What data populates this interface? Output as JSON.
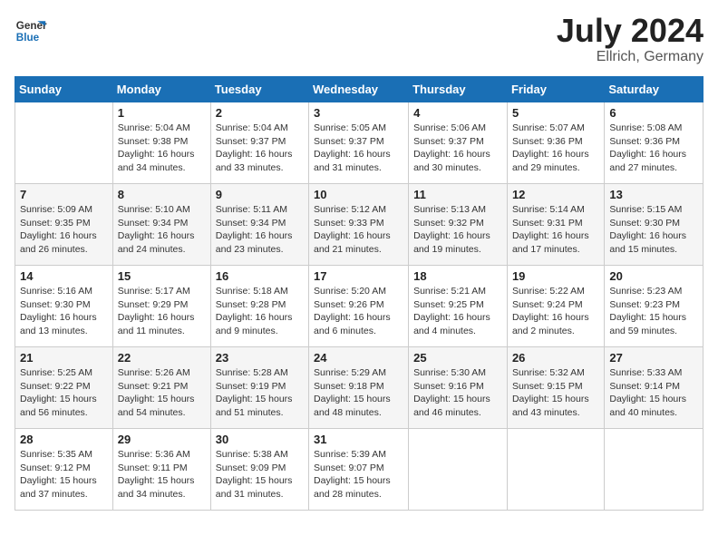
{
  "header": {
    "logo_line1": "General",
    "logo_line2": "Blue",
    "month": "July 2024",
    "location": "Ellrich, Germany"
  },
  "weekdays": [
    "Sunday",
    "Monday",
    "Tuesday",
    "Wednesday",
    "Thursday",
    "Friday",
    "Saturday"
  ],
  "weeks": [
    [
      {
        "day": "",
        "sunrise": "",
        "sunset": "",
        "daylight": ""
      },
      {
        "day": "1",
        "sunrise": "Sunrise: 5:04 AM",
        "sunset": "Sunset: 9:38 PM",
        "daylight": "Daylight: 16 hours and 34 minutes."
      },
      {
        "day": "2",
        "sunrise": "Sunrise: 5:04 AM",
        "sunset": "Sunset: 9:37 PM",
        "daylight": "Daylight: 16 hours and 33 minutes."
      },
      {
        "day": "3",
        "sunrise": "Sunrise: 5:05 AM",
        "sunset": "Sunset: 9:37 PM",
        "daylight": "Daylight: 16 hours and 31 minutes."
      },
      {
        "day": "4",
        "sunrise": "Sunrise: 5:06 AM",
        "sunset": "Sunset: 9:37 PM",
        "daylight": "Daylight: 16 hours and 30 minutes."
      },
      {
        "day": "5",
        "sunrise": "Sunrise: 5:07 AM",
        "sunset": "Sunset: 9:36 PM",
        "daylight": "Daylight: 16 hours and 29 minutes."
      },
      {
        "day": "6",
        "sunrise": "Sunrise: 5:08 AM",
        "sunset": "Sunset: 9:36 PM",
        "daylight": "Daylight: 16 hours and 27 minutes."
      }
    ],
    [
      {
        "day": "7",
        "sunrise": "Sunrise: 5:09 AM",
        "sunset": "Sunset: 9:35 PM",
        "daylight": "Daylight: 16 hours and 26 minutes."
      },
      {
        "day": "8",
        "sunrise": "Sunrise: 5:10 AM",
        "sunset": "Sunset: 9:34 PM",
        "daylight": "Daylight: 16 hours and 24 minutes."
      },
      {
        "day": "9",
        "sunrise": "Sunrise: 5:11 AM",
        "sunset": "Sunset: 9:34 PM",
        "daylight": "Daylight: 16 hours and 23 minutes."
      },
      {
        "day": "10",
        "sunrise": "Sunrise: 5:12 AM",
        "sunset": "Sunset: 9:33 PM",
        "daylight": "Daylight: 16 hours and 21 minutes."
      },
      {
        "day": "11",
        "sunrise": "Sunrise: 5:13 AM",
        "sunset": "Sunset: 9:32 PM",
        "daylight": "Daylight: 16 hours and 19 minutes."
      },
      {
        "day": "12",
        "sunrise": "Sunrise: 5:14 AM",
        "sunset": "Sunset: 9:31 PM",
        "daylight": "Daylight: 16 hours and 17 minutes."
      },
      {
        "day": "13",
        "sunrise": "Sunrise: 5:15 AM",
        "sunset": "Sunset: 9:30 PM",
        "daylight": "Daylight: 16 hours and 15 minutes."
      }
    ],
    [
      {
        "day": "14",
        "sunrise": "Sunrise: 5:16 AM",
        "sunset": "Sunset: 9:30 PM",
        "daylight": "Daylight: 16 hours and 13 minutes."
      },
      {
        "day": "15",
        "sunrise": "Sunrise: 5:17 AM",
        "sunset": "Sunset: 9:29 PM",
        "daylight": "Daylight: 16 hours and 11 minutes."
      },
      {
        "day": "16",
        "sunrise": "Sunrise: 5:18 AM",
        "sunset": "Sunset: 9:28 PM",
        "daylight": "Daylight: 16 hours and 9 minutes."
      },
      {
        "day": "17",
        "sunrise": "Sunrise: 5:20 AM",
        "sunset": "Sunset: 9:26 PM",
        "daylight": "Daylight: 16 hours and 6 minutes."
      },
      {
        "day": "18",
        "sunrise": "Sunrise: 5:21 AM",
        "sunset": "Sunset: 9:25 PM",
        "daylight": "Daylight: 16 hours and 4 minutes."
      },
      {
        "day": "19",
        "sunrise": "Sunrise: 5:22 AM",
        "sunset": "Sunset: 9:24 PM",
        "daylight": "Daylight: 16 hours and 2 minutes."
      },
      {
        "day": "20",
        "sunrise": "Sunrise: 5:23 AM",
        "sunset": "Sunset: 9:23 PM",
        "daylight": "Daylight: 15 hours and 59 minutes."
      }
    ],
    [
      {
        "day": "21",
        "sunrise": "Sunrise: 5:25 AM",
        "sunset": "Sunset: 9:22 PM",
        "daylight": "Daylight: 15 hours and 56 minutes."
      },
      {
        "day": "22",
        "sunrise": "Sunrise: 5:26 AM",
        "sunset": "Sunset: 9:21 PM",
        "daylight": "Daylight: 15 hours and 54 minutes."
      },
      {
        "day": "23",
        "sunrise": "Sunrise: 5:28 AM",
        "sunset": "Sunset: 9:19 PM",
        "daylight": "Daylight: 15 hours and 51 minutes."
      },
      {
        "day": "24",
        "sunrise": "Sunrise: 5:29 AM",
        "sunset": "Sunset: 9:18 PM",
        "daylight": "Daylight: 15 hours and 48 minutes."
      },
      {
        "day": "25",
        "sunrise": "Sunrise: 5:30 AM",
        "sunset": "Sunset: 9:16 PM",
        "daylight": "Daylight: 15 hours and 46 minutes."
      },
      {
        "day": "26",
        "sunrise": "Sunrise: 5:32 AM",
        "sunset": "Sunset: 9:15 PM",
        "daylight": "Daylight: 15 hours and 43 minutes."
      },
      {
        "day": "27",
        "sunrise": "Sunrise: 5:33 AM",
        "sunset": "Sunset: 9:14 PM",
        "daylight": "Daylight: 15 hours and 40 minutes."
      }
    ],
    [
      {
        "day": "28",
        "sunrise": "Sunrise: 5:35 AM",
        "sunset": "Sunset: 9:12 PM",
        "daylight": "Daylight: 15 hours and 37 minutes."
      },
      {
        "day": "29",
        "sunrise": "Sunrise: 5:36 AM",
        "sunset": "Sunset: 9:11 PM",
        "daylight": "Daylight: 15 hours and 34 minutes."
      },
      {
        "day": "30",
        "sunrise": "Sunrise: 5:38 AM",
        "sunset": "Sunset: 9:09 PM",
        "daylight": "Daylight: 15 hours and 31 minutes."
      },
      {
        "day": "31",
        "sunrise": "Sunrise: 5:39 AM",
        "sunset": "Sunset: 9:07 PM",
        "daylight": "Daylight: 15 hours and 28 minutes."
      },
      {
        "day": "",
        "sunrise": "",
        "sunset": "",
        "daylight": ""
      },
      {
        "day": "",
        "sunrise": "",
        "sunset": "",
        "daylight": ""
      },
      {
        "day": "",
        "sunrise": "",
        "sunset": "",
        "daylight": ""
      }
    ]
  ]
}
